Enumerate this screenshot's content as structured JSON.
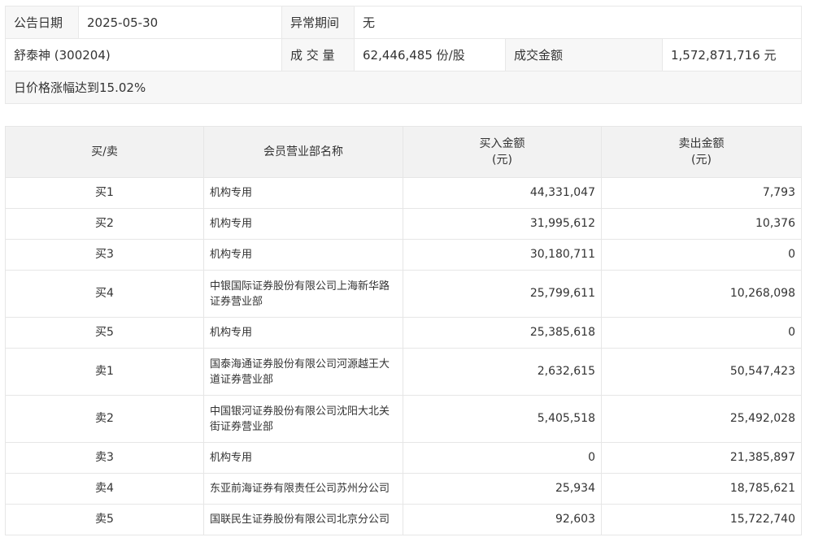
{
  "announce": {
    "date_label": "公告日期",
    "date_value": "2025-05-30",
    "abnormal_label": "异常期间",
    "abnormal_value": "无",
    "stock": "舒泰神 (300204)",
    "volume_label": "成 交 量",
    "volume_value": "62,446,485 份/股",
    "turnover_label": "成交金额",
    "turnover_value": "1,572,871,716 元",
    "reason": "日价格涨幅达到15.02%"
  },
  "table": {
    "headers": {
      "side": "买/卖",
      "member": "会员营业部名称",
      "buy_line1": "买入金额",
      "buy_line2": "(元)",
      "sell_line1": "卖出金额",
      "sell_line2": "(元)"
    },
    "rows": [
      {
        "side": "买1",
        "name_l1": "机构专用",
        "name_l2": "",
        "buy": "44,331,047",
        "sell": "7,793"
      },
      {
        "side": "买2",
        "name_l1": "机构专用",
        "name_l2": "",
        "buy": "31,995,612",
        "sell": "10,376"
      },
      {
        "side": "买3",
        "name_l1": "机构专用",
        "name_l2": "",
        "buy": "30,180,711",
        "sell": "0"
      },
      {
        "side": "买4",
        "name_l1": "中银国际证券股份有限公司上海新华路",
        "name_l2": "证券营业部",
        "buy": "25,799,611",
        "sell": "10,268,098"
      },
      {
        "side": "买5",
        "name_l1": "机构专用",
        "name_l2": "",
        "buy": "25,385,618",
        "sell": "0"
      },
      {
        "side": "卖1",
        "name_l1": "国泰海通证券股份有限公司河源越王大",
        "name_l2": "道证券营业部",
        "buy": "2,632,615",
        "sell": "50,547,423"
      },
      {
        "side": "卖2",
        "name_l1": "中国银河证券股份有限公司沈阳大北关",
        "name_l2": "街证券营业部",
        "buy": "5,405,518",
        "sell": "25,492,028"
      },
      {
        "side": "卖3",
        "name_l1": "机构专用",
        "name_l2": "",
        "buy": "0",
        "sell": "21,385,897"
      },
      {
        "side": "卖4",
        "name_l1": "东亚前海证券有限责任公司苏州分公司",
        "name_l2": "",
        "buy": "25,934",
        "sell": "18,785,621"
      },
      {
        "side": "卖5",
        "name_l1": "国联民生证券股份有限公司北京分公司",
        "name_l2": "",
        "buy": "92,603",
        "sell": "15,722,740"
      }
    ]
  }
}
